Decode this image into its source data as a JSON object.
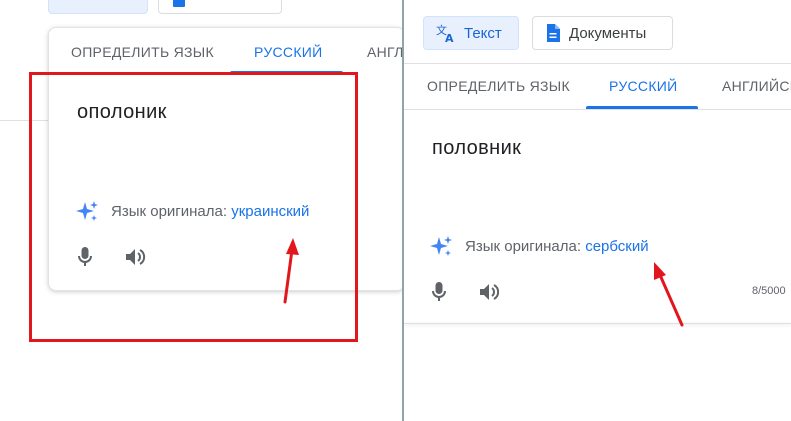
{
  "left_window": {
    "tabs": [
      {
        "label": "ОПРЕДЕЛИТЬ ЯЗЫК",
        "active": false
      },
      {
        "label": "РУССКИЙ",
        "active": true
      },
      {
        "label": "АНГЛИ",
        "active": false
      }
    ],
    "source_text": "ополоник",
    "detected_prefix": "Язык оригинала:",
    "detected_language": "украинский",
    "icons": {
      "mic": "mic-icon",
      "speaker": "speaker-icon",
      "sparkle": "sparkle-icon"
    }
  },
  "right_window": {
    "mode_buttons": [
      {
        "label": "Текст",
        "icon": "translate-icon",
        "active": true
      },
      {
        "label": "Документы",
        "icon": "document-icon",
        "active": false
      }
    ],
    "tabs": [
      {
        "label": "ОПРЕДЕЛИТЬ ЯЗЫК",
        "active": false
      },
      {
        "label": "РУССКИЙ",
        "active": true
      },
      {
        "label": "АНГЛИЙСК",
        "active": false
      }
    ],
    "source_text": "половник",
    "detected_prefix": "Язык оригинала:",
    "detected_language": "сербский",
    "char_count": "8/5000",
    "icons": {
      "mic": "mic-icon",
      "speaker": "speaker-icon",
      "sparkle": "sparkle-icon"
    }
  },
  "colors": {
    "accent": "#1a73e8",
    "annotation_red": "#e2161d",
    "text_secondary": "#5f6368"
  }
}
